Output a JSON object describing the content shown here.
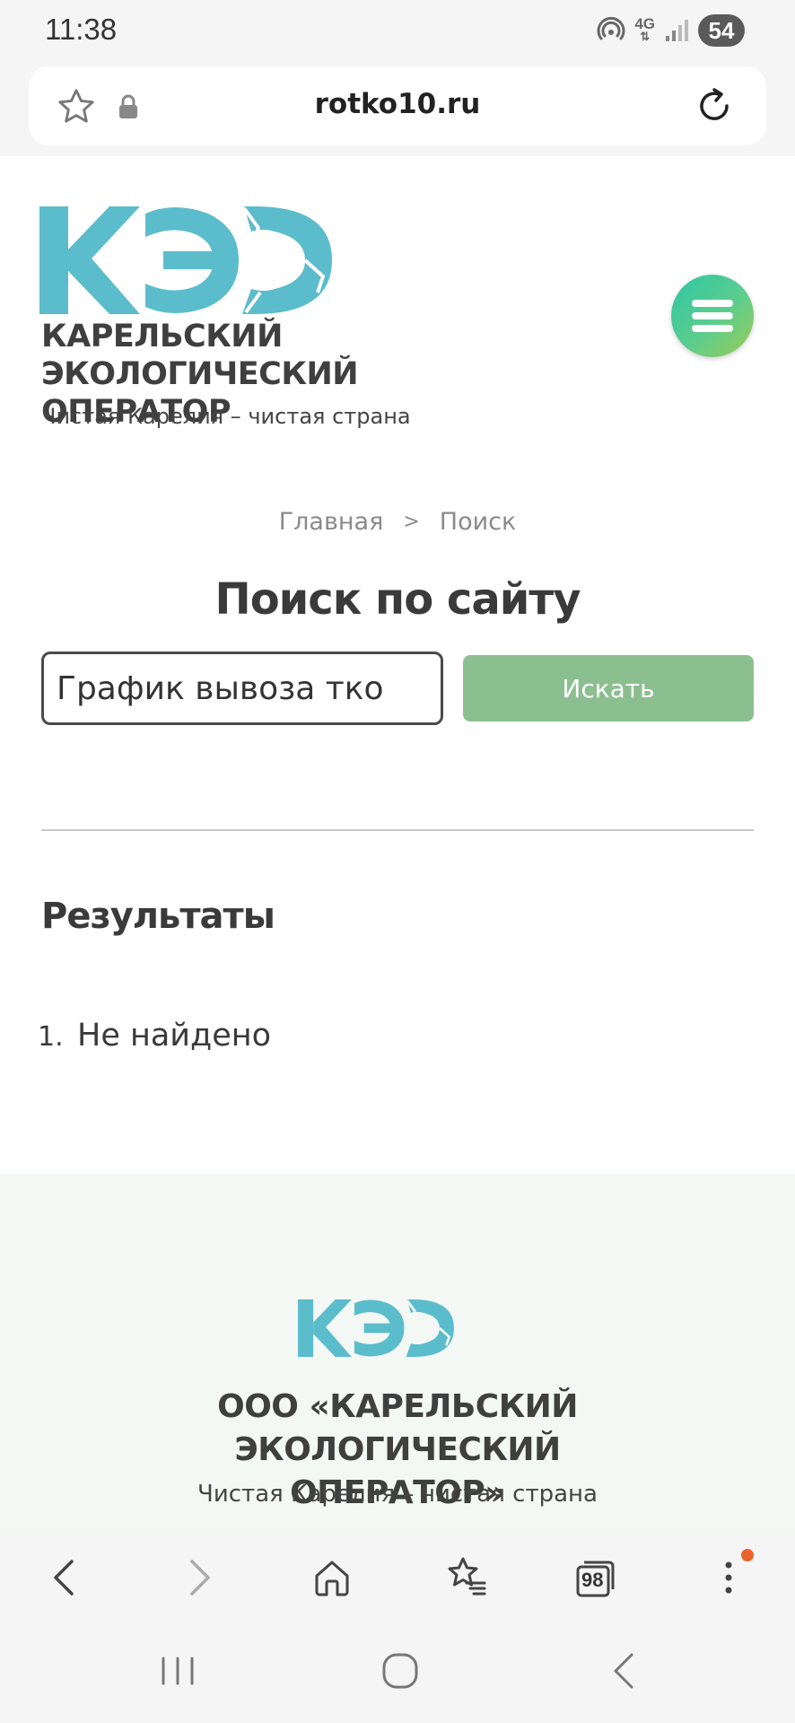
{
  "status_bar": {
    "time": "11:38",
    "network": "4G",
    "battery": "54"
  },
  "browser": {
    "url": "rotko10.ru",
    "tabs_count": "98"
  },
  "header": {
    "logo_icon": "keo-logo",
    "org_name_line1": "КАРЕЛЬСКИЙ ЭКОЛОГИЧЕСКИЙ",
    "org_name_line2": "ОПЕРАТОР",
    "tagline": "Чистая Карелия – чистая страна",
    "menu_icon": "hamburger-icon"
  },
  "breadcrumb": {
    "home": "Главная",
    "separator": ">",
    "current": "Поиск"
  },
  "page_title": "Поиск по сайту",
  "search": {
    "value": "График вывоза тко",
    "button_label": "Искать"
  },
  "results": {
    "heading": "Результаты",
    "items": [
      {
        "number": "1.",
        "text": "Не найдено"
      }
    ]
  },
  "footer": {
    "org_name_line1": "ООО «КАРЕЛЬСКИЙ ЭКОЛОГИЧЕСКИЙ",
    "org_name_line2": "ОПЕРАТОР»",
    "tagline": "Чистая Карелия – чистая страна"
  },
  "colors": {
    "brand_teal": "#5bbccc",
    "search_button": "#8cbf90",
    "menu_gradient_start": "#2fc7a7",
    "menu_gradient_end": "#9ccc55",
    "notification_dot": "#e8642c"
  }
}
